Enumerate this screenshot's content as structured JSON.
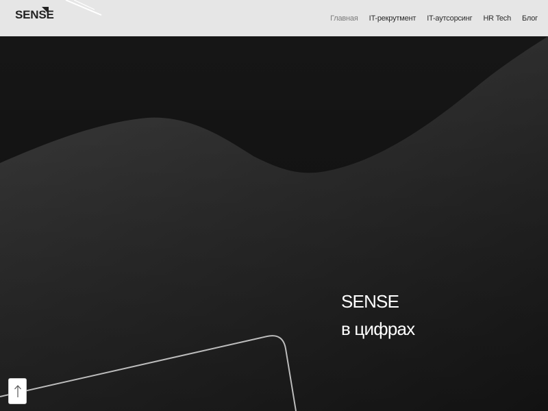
{
  "header": {
    "logo_text": "SENSE",
    "logo_mark_icon": "corner-triangle-icon",
    "nav": [
      {
        "label": "Главная",
        "active": true
      },
      {
        "label": "IT-рекрутмент",
        "active": false
      },
      {
        "label": "IT-аутсорсинг",
        "active": false
      },
      {
        "label": "HR Tech",
        "active": false
      },
      {
        "label": "Блог",
        "active": false
      }
    ]
  },
  "hero": {
    "title_line1": "SENSE",
    "title_line2": "в цифрах"
  },
  "scroll_top": {
    "icon": "arrow-up-icon"
  },
  "colors": {
    "header_bg": "#e6e6e6",
    "hero_dark": "#161616",
    "hero_wave": "#3a3a3a",
    "text_light": "#ffffff",
    "nav_active": "#7a7a7a"
  }
}
